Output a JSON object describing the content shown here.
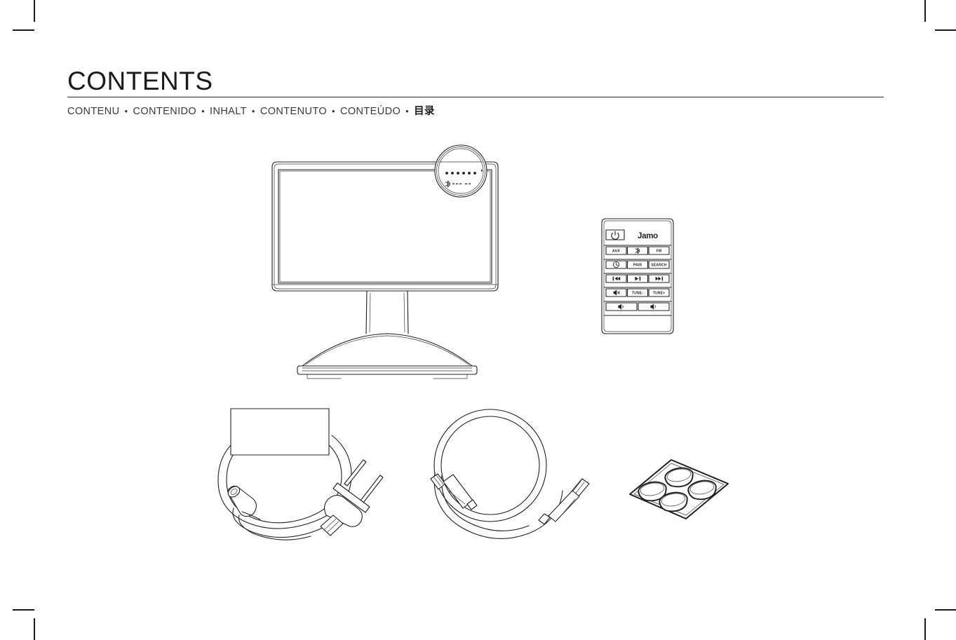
{
  "page": {
    "title": "CONTENTS",
    "subtitle_items": [
      {
        "text": "CONTENU",
        "lang": "fr",
        "bold": false
      },
      {
        "text": "CONTENIDO",
        "lang": "es",
        "bold": false
      },
      {
        "text": "INHALT",
        "lang": "de",
        "bold": false
      },
      {
        "text": "CONTENUTO",
        "lang": "it",
        "bold": false
      },
      {
        "text": "CONTEÚDO",
        "lang": "pt",
        "bold": false
      },
      {
        "text": "目录",
        "lang": "zh",
        "bold": true
      }
    ],
    "separator": "•",
    "background_color": "#ffffff",
    "line_color": "#231f20",
    "text_color": "#1b1b1b"
  },
  "crop_marks": {
    "present": true,
    "corners": [
      "top-left",
      "top-right",
      "bottom-left",
      "bottom-right"
    ]
  },
  "contents_items": [
    {
      "id": "soundbar",
      "name": "soundbar-speaker-unit",
      "description": "Soundbar speaker with display panel and pedestal stand",
      "callout": {
        "type": "magnifier-circle",
        "indicator_dots": 6,
        "icons": [
          "bluetooth-icon"
        ]
      }
    },
    {
      "id": "remote",
      "name": "remote-control",
      "description": "Infrared remote control",
      "brand": "Jamo",
      "button_rows": [
        [
          {
            "key": "power",
            "label": "",
            "icon": "power-icon",
            "span": 1
          },
          {
            "key": "brand",
            "label": "Jamo",
            "icon": "jamo-logo",
            "span": 2
          }
        ],
        [
          {
            "key": "aux",
            "label": "AUX",
            "icon": "",
            "span": 1
          },
          {
            "key": "bluetooth",
            "label": "",
            "icon": "bluetooth-icon",
            "span": 1
          },
          {
            "key": "fm",
            "label": "FM",
            "icon": "",
            "span": 1
          }
        ],
        [
          {
            "key": "sleep",
            "label": "",
            "icon": "clock-icon",
            "span": 1
          },
          {
            "key": "pair",
            "label": "PAIR",
            "icon": "",
            "span": 1
          },
          {
            "key": "search",
            "label": "SEARCH",
            "icon": "",
            "span": 1
          }
        ],
        [
          {
            "key": "previous",
            "label": "",
            "icon": "previous-track-icon",
            "span": 1
          },
          {
            "key": "play-pause",
            "label": "",
            "icon": "play-pause-icon",
            "span": 1
          },
          {
            "key": "next",
            "label": "",
            "icon": "next-track-icon",
            "span": 1
          }
        ],
        [
          {
            "key": "mute",
            "label": "",
            "icon": "mute-icon",
            "span": 1
          },
          {
            "key": "tune-down",
            "label": "TUNE-",
            "icon": "",
            "span": 1
          },
          {
            "key": "tune-up",
            "label": "TUNE+",
            "icon": "",
            "span": 1
          }
        ],
        [
          {
            "key": "volume-down",
            "label": "",
            "icon": "volume-icon",
            "span": 1.5
          },
          {
            "key": "volume-up",
            "label": "",
            "icon": "volume-icon",
            "span": 1.5
          }
        ]
      ]
    },
    {
      "id": "power-cable",
      "name": "power-adapter-cable",
      "description": "Coiled power cable with two-prong plug and barrel connector"
    },
    {
      "id": "aux-cable",
      "name": "aux-audio-cable",
      "description": "Coiled 3.5 mm auxiliary audio cable with two jack plugs"
    },
    {
      "id": "rubber-feet",
      "name": "rubber-feet-sheet",
      "description": "Adhesive sheet with four rubber feet pads",
      "pad_count": 4
    }
  ]
}
